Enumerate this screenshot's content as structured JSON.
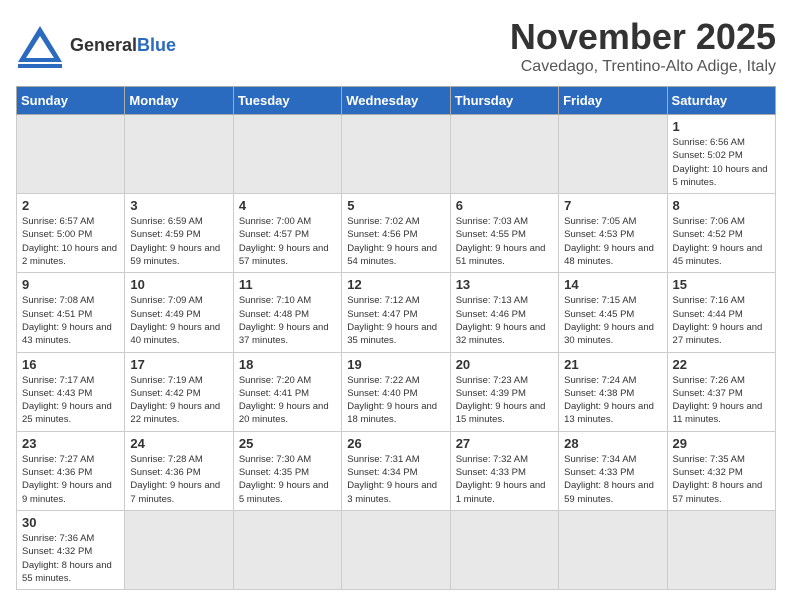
{
  "header": {
    "logo_general": "General",
    "logo_blue": "Blue",
    "month_title": "November 2025",
    "location": "Cavedago, Trentino-Alto Adige, Italy"
  },
  "weekdays": [
    "Sunday",
    "Monday",
    "Tuesday",
    "Wednesday",
    "Thursday",
    "Friday",
    "Saturday"
  ],
  "weeks": [
    [
      {
        "day": "",
        "info": ""
      },
      {
        "day": "",
        "info": ""
      },
      {
        "day": "",
        "info": ""
      },
      {
        "day": "",
        "info": ""
      },
      {
        "day": "",
        "info": ""
      },
      {
        "day": "",
        "info": ""
      },
      {
        "day": "1",
        "info": "Sunrise: 6:56 AM\nSunset: 5:02 PM\nDaylight: 10 hours and 5 minutes."
      }
    ],
    [
      {
        "day": "2",
        "info": "Sunrise: 6:57 AM\nSunset: 5:00 PM\nDaylight: 10 hours and 2 minutes."
      },
      {
        "day": "3",
        "info": "Sunrise: 6:59 AM\nSunset: 4:59 PM\nDaylight: 9 hours and 59 minutes."
      },
      {
        "day": "4",
        "info": "Sunrise: 7:00 AM\nSunset: 4:57 PM\nDaylight: 9 hours and 57 minutes."
      },
      {
        "day": "5",
        "info": "Sunrise: 7:02 AM\nSunset: 4:56 PM\nDaylight: 9 hours and 54 minutes."
      },
      {
        "day": "6",
        "info": "Sunrise: 7:03 AM\nSunset: 4:55 PM\nDaylight: 9 hours and 51 minutes."
      },
      {
        "day": "7",
        "info": "Sunrise: 7:05 AM\nSunset: 4:53 PM\nDaylight: 9 hours and 48 minutes."
      },
      {
        "day": "8",
        "info": "Sunrise: 7:06 AM\nSunset: 4:52 PM\nDaylight: 9 hours and 45 minutes."
      }
    ],
    [
      {
        "day": "9",
        "info": "Sunrise: 7:08 AM\nSunset: 4:51 PM\nDaylight: 9 hours and 43 minutes."
      },
      {
        "day": "10",
        "info": "Sunrise: 7:09 AM\nSunset: 4:49 PM\nDaylight: 9 hours and 40 minutes."
      },
      {
        "day": "11",
        "info": "Sunrise: 7:10 AM\nSunset: 4:48 PM\nDaylight: 9 hours and 37 minutes."
      },
      {
        "day": "12",
        "info": "Sunrise: 7:12 AM\nSunset: 4:47 PM\nDaylight: 9 hours and 35 minutes."
      },
      {
        "day": "13",
        "info": "Sunrise: 7:13 AM\nSunset: 4:46 PM\nDaylight: 9 hours and 32 minutes."
      },
      {
        "day": "14",
        "info": "Sunrise: 7:15 AM\nSunset: 4:45 PM\nDaylight: 9 hours and 30 minutes."
      },
      {
        "day": "15",
        "info": "Sunrise: 7:16 AM\nSunset: 4:44 PM\nDaylight: 9 hours and 27 minutes."
      }
    ],
    [
      {
        "day": "16",
        "info": "Sunrise: 7:17 AM\nSunset: 4:43 PM\nDaylight: 9 hours and 25 minutes."
      },
      {
        "day": "17",
        "info": "Sunrise: 7:19 AM\nSunset: 4:42 PM\nDaylight: 9 hours and 22 minutes."
      },
      {
        "day": "18",
        "info": "Sunrise: 7:20 AM\nSunset: 4:41 PM\nDaylight: 9 hours and 20 minutes."
      },
      {
        "day": "19",
        "info": "Sunrise: 7:22 AM\nSunset: 4:40 PM\nDaylight: 9 hours and 18 minutes."
      },
      {
        "day": "20",
        "info": "Sunrise: 7:23 AM\nSunset: 4:39 PM\nDaylight: 9 hours and 15 minutes."
      },
      {
        "day": "21",
        "info": "Sunrise: 7:24 AM\nSunset: 4:38 PM\nDaylight: 9 hours and 13 minutes."
      },
      {
        "day": "22",
        "info": "Sunrise: 7:26 AM\nSunset: 4:37 PM\nDaylight: 9 hours and 11 minutes."
      }
    ],
    [
      {
        "day": "23",
        "info": "Sunrise: 7:27 AM\nSunset: 4:36 PM\nDaylight: 9 hours and 9 minutes."
      },
      {
        "day": "24",
        "info": "Sunrise: 7:28 AM\nSunset: 4:36 PM\nDaylight: 9 hours and 7 minutes."
      },
      {
        "day": "25",
        "info": "Sunrise: 7:30 AM\nSunset: 4:35 PM\nDaylight: 9 hours and 5 minutes."
      },
      {
        "day": "26",
        "info": "Sunrise: 7:31 AM\nSunset: 4:34 PM\nDaylight: 9 hours and 3 minutes."
      },
      {
        "day": "27",
        "info": "Sunrise: 7:32 AM\nSunset: 4:33 PM\nDaylight: 9 hours and 1 minute."
      },
      {
        "day": "28",
        "info": "Sunrise: 7:34 AM\nSunset: 4:33 PM\nDaylight: 8 hours and 59 minutes."
      },
      {
        "day": "29",
        "info": "Sunrise: 7:35 AM\nSunset: 4:32 PM\nDaylight: 8 hours and 57 minutes."
      }
    ],
    [
      {
        "day": "30",
        "info": "Sunrise: 7:36 AM\nSunset: 4:32 PM\nDaylight: 8 hours and 55 minutes."
      },
      {
        "day": "",
        "info": ""
      },
      {
        "day": "",
        "info": ""
      },
      {
        "day": "",
        "info": ""
      },
      {
        "day": "",
        "info": ""
      },
      {
        "day": "",
        "info": ""
      },
      {
        "day": "",
        "info": ""
      }
    ]
  ]
}
